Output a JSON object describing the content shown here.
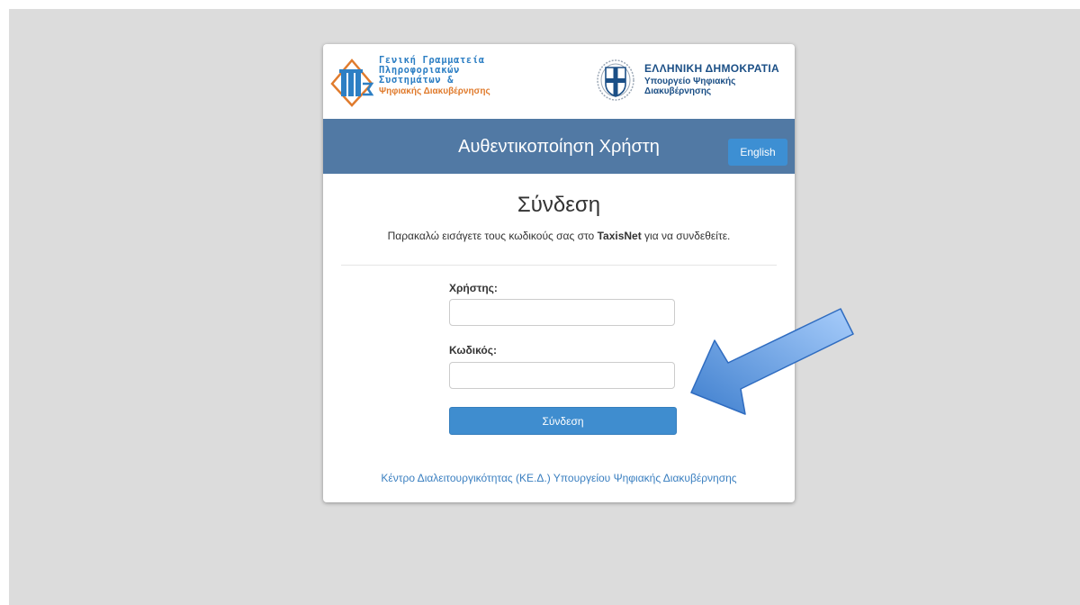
{
  "header": {
    "gsis_logo_lines": [
      "Γενική Γραμματεία",
      "Πληροφοριακών",
      "Συστημάτων &",
      "Ψηφιακής Διακυβέρνησης"
    ],
    "gov_title": "ΕΛΛΗΝΙΚΗ ΔΗΜΟΚΡΑΤΙΑ",
    "gov_sub_line1": "Υπουργείο Ψηφιακής",
    "gov_sub_line2": "Διακυβέρνησης",
    "band_title": "Αυθεντικοποίηση Χρήστη",
    "language_button": "English"
  },
  "login": {
    "title": "Σύνδεση",
    "intro_before": "Παρακαλώ εισάγετε τους κωδικούς σας στο ",
    "intro_bold": "TaxisNet",
    "intro_after": " για να συνδεθείτε.",
    "username_label": "Χρήστης:",
    "username_value": "",
    "password_label": "Κωδικός:",
    "password_value": "",
    "submit_label": "Σύνδεση"
  },
  "footer": {
    "link_text": "Κέντρο Διαλειτουργικότητας (ΚΕ.Δ.) Υπουργείου Ψηφιακής Διακυβέρνησης"
  },
  "colors": {
    "band": "#5179a4",
    "button": "#3f8dcf",
    "link": "#3a7fc0",
    "gsis_blue": "#2d7fc4",
    "gsis_orange": "#e07b2d",
    "gov_blue": "#1b4f86"
  },
  "icons": [
    "gsis-logo-icon",
    "greek-seal-icon",
    "pointer-arrow-icon"
  ]
}
